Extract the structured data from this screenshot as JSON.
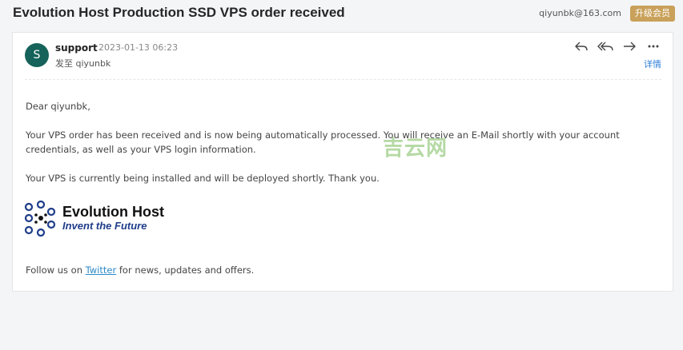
{
  "email": {
    "subject": "Evolution Host Production SSD VPS order received",
    "account": "qiyunbk@163.com",
    "vip_label": "升级会员",
    "sender": {
      "avatar_letter": "S",
      "name": "support",
      "date": "2023-01-13 06:23",
      "recipient": "发至 qiyunbk"
    },
    "actions": [
      "reply-icon",
      "reply-all-icon",
      "forward-icon",
      "more-icon"
    ],
    "details_label": "详情",
    "body": {
      "greeting": "Dear qiyunbk,",
      "paragraph1": "Your VPS order has been received and is now being automatically processed. You will receive an E-Mail shortly with your account credentials, as well as your VPS login information.",
      "paragraph2": "Your VPS is currently being installed and will be deployed shortly. Thank you.",
      "logo_title": "Evolution Host",
      "logo_tagline": "Invent the Future",
      "follow_prefix": "Follow us on ",
      "follow_link": "Twitter",
      "follow_suffix": " for news, updates and offers."
    },
    "watermark": "吉云网"
  },
  "colors": {
    "avatar": "#15635a",
    "vip": "#c9a15a",
    "link": "#2d7ed8",
    "logo_blue": "#1f3d8a"
  }
}
